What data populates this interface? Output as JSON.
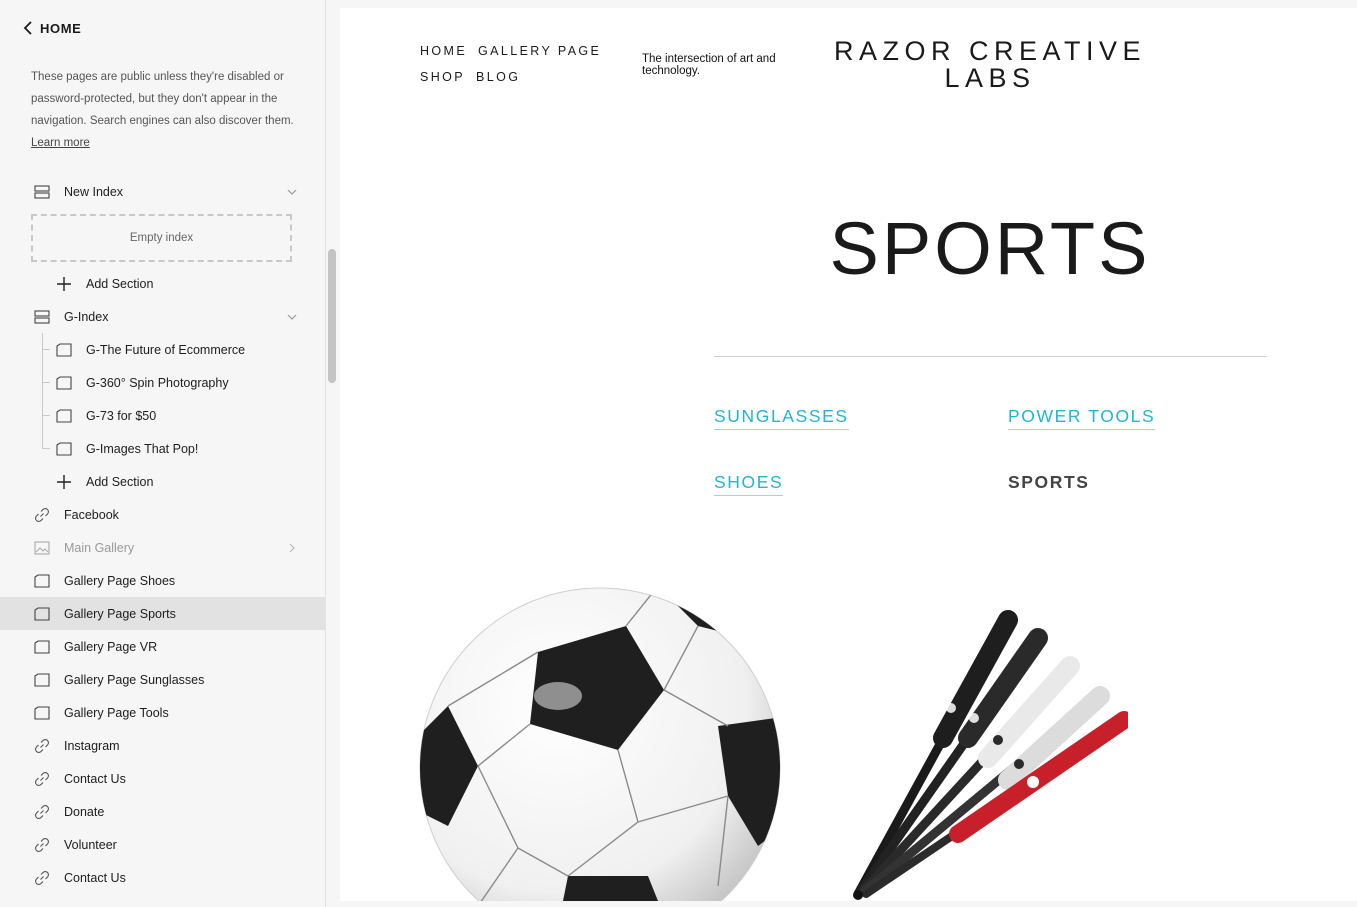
{
  "sidebar": {
    "home_label": "HOME",
    "description": "These pages are public unless they're disabled or password-protected, but they don't appear in the navigation. Search engines can also discover them.",
    "learn_more": "Learn more",
    "items": [
      {
        "label": "New Index",
        "icon": "index-icon",
        "chevron": "down"
      },
      {
        "label": "Empty index"
      },
      {
        "label": "Add Section",
        "icon": "plus-icon"
      },
      {
        "label": "G-Index",
        "icon": "index-icon",
        "chevron": "down"
      },
      {
        "label": "G-The Future of Ecommerce",
        "icon": "page-icon"
      },
      {
        "label": "G-360° Spin Photography",
        "icon": "page-icon"
      },
      {
        "label": "G-73 for $50",
        "icon": "page-icon"
      },
      {
        "label": "G-Images That Pop!",
        "icon": "page-icon"
      },
      {
        "label": "Add Section",
        "icon": "plus-icon"
      },
      {
        "label": "Facebook",
        "icon": "link-icon"
      },
      {
        "label": "Main Gallery",
        "icon": "gallery-icon",
        "chevron": "right",
        "disabled": true
      },
      {
        "label": "Gallery Page Shoes",
        "icon": "page-icon"
      },
      {
        "label": "Gallery Page Sports",
        "icon": "page-icon",
        "active": true
      },
      {
        "label": "Gallery Page VR",
        "icon": "page-icon"
      },
      {
        "label": "Gallery Page Sunglasses",
        "icon": "page-icon"
      },
      {
        "label": "Gallery Page Tools",
        "icon": "page-icon"
      },
      {
        "label": "Instagram",
        "icon": "link-icon"
      },
      {
        "label": "Contact Us",
        "icon": "link-icon"
      },
      {
        "label": "Donate",
        "icon": "link-icon"
      },
      {
        "label": "Volunteer",
        "icon": "link-icon"
      },
      {
        "label": "Contact Us",
        "icon": "link-icon"
      }
    ]
  },
  "site": {
    "nav": [
      "HOME",
      "GALLERY PAGE",
      "SHOP",
      "BLOG"
    ],
    "tagline": "The intersection of art and technology.",
    "title": "RAZOR CREATIVE LABS",
    "page_heading": "SPORTS",
    "categories": [
      {
        "label": "SUNGLASSES",
        "current": false
      },
      {
        "label": "POWER TOOLS",
        "current": false
      },
      {
        "label": "SHOES",
        "current": false
      },
      {
        "label": "SPORTS",
        "current": true
      }
    ],
    "link_color": "#1fb6d1",
    "active_bg": "#e2e2e2"
  }
}
